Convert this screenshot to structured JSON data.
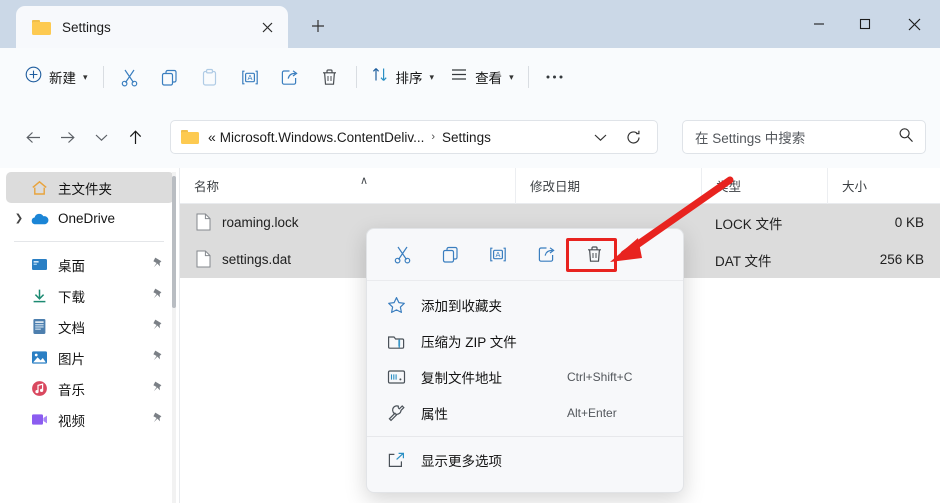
{
  "window": {
    "tab": {
      "title": "Settings",
      "icon": "folder-icon",
      "close_icon": "close-icon"
    },
    "new_tab_icon": "plus-icon",
    "controls": {
      "minimize": "–",
      "maximize": "□",
      "close": "✕"
    }
  },
  "toolbar": {
    "new_label": "新建",
    "new_icon": "plus-circle-icon",
    "buttons": [
      {
        "name": "cut-button",
        "icon": "scissors-icon",
        "enabled": true
      },
      {
        "name": "copy-button",
        "icon": "copy-icon",
        "enabled": true
      },
      {
        "name": "paste-button",
        "icon": "paste-icon",
        "enabled": false
      },
      {
        "name": "rename-button",
        "icon": "rename-icon",
        "enabled": true
      },
      {
        "name": "share-button",
        "icon": "share-icon",
        "enabled": true
      },
      {
        "name": "delete-button",
        "icon": "trash-icon",
        "enabled": true
      }
    ],
    "sort_label": "排序",
    "sort_icon": "sort-arrows-icon",
    "view_label": "查看",
    "view_icon": "view-list-icon",
    "more_label": "•••"
  },
  "address": {
    "back_icon": "arrow-left-icon",
    "forward_icon": "arrow-right-icon",
    "recent_icon": "chevron-down-icon",
    "up_icon": "arrow-up-icon",
    "folder_icon": "folder-icon",
    "prefix": "«",
    "segment1": "Microsoft.Windows.ContentDeliv...",
    "separator": "›",
    "segment2": "Settings",
    "dropdown_icon": "chevron-down-icon",
    "refresh_icon": "refresh-icon"
  },
  "search": {
    "placeholder": "在 Settings 中搜索",
    "icon": "search-icon"
  },
  "sidebar": {
    "items": [
      {
        "label": "主文件夹",
        "icon": "home-icon",
        "selected": true,
        "expander": false,
        "pinned": false
      },
      {
        "label": "OneDrive",
        "icon": "cloud-icon",
        "selected": false,
        "expander": true,
        "pinned": false
      },
      {
        "label": "桌面",
        "icon": "desktop-icon",
        "selected": false,
        "expander": false,
        "pinned": true
      },
      {
        "label": "下载",
        "icon": "download-icon",
        "selected": false,
        "expander": false,
        "pinned": true
      },
      {
        "label": "文档",
        "icon": "document-icon",
        "selected": false,
        "expander": false,
        "pinned": true
      },
      {
        "label": "图片",
        "icon": "pictures-icon",
        "selected": false,
        "expander": false,
        "pinned": true
      },
      {
        "label": "音乐",
        "icon": "music-icon",
        "selected": false,
        "expander": false,
        "pinned": true
      },
      {
        "label": "视频",
        "icon": "video-icon",
        "selected": false,
        "expander": false,
        "pinned": true
      }
    ]
  },
  "filelist": {
    "columns": [
      {
        "label": "名称",
        "sorted": "asc"
      },
      {
        "label": "修改日期",
        "sorted": ""
      },
      {
        "label": "类型",
        "sorted": ""
      },
      {
        "label": "大小",
        "sorted": ""
      }
    ],
    "sort_indicator": "∧",
    "rows": [
      {
        "name": "roaming.lock",
        "date": "",
        "type": "LOCK 文件",
        "size": "0 KB",
        "selected": true
      },
      {
        "name": "settings.dat",
        "date": "",
        "type": "DAT 文件",
        "size": "256 KB",
        "selected": true
      }
    ]
  },
  "contextmenu": {
    "top_actions": [
      {
        "name": "ctx-cut-button",
        "icon": "scissors-icon",
        "highlighted": false
      },
      {
        "name": "ctx-copy-button",
        "icon": "copy-icon",
        "highlighted": false
      },
      {
        "name": "ctx-rename-button",
        "icon": "rename-icon",
        "highlighted": false
      },
      {
        "name": "ctx-share-button",
        "icon": "share-icon",
        "highlighted": false
      },
      {
        "name": "ctx-delete-button",
        "icon": "trash-icon",
        "highlighted": true
      }
    ],
    "items": [
      {
        "label": "添加到收藏夹",
        "icon": "star-icon",
        "accel": ""
      },
      {
        "label": "压缩为 ZIP 文件",
        "icon": "zip-folder-icon",
        "accel": ""
      },
      {
        "label": "复制文件地址",
        "icon": "copy-path-icon",
        "accel": "Ctrl+Shift+C"
      },
      {
        "label": "属性",
        "icon": "wrench-icon",
        "accel": "Alt+Enter"
      },
      {
        "label": "显示更多选项",
        "icon": "more-options-icon",
        "accel": ""
      }
    ]
  },
  "annotation": {
    "highlight_color": "#e8231f",
    "target": "ctx-delete-button"
  }
}
